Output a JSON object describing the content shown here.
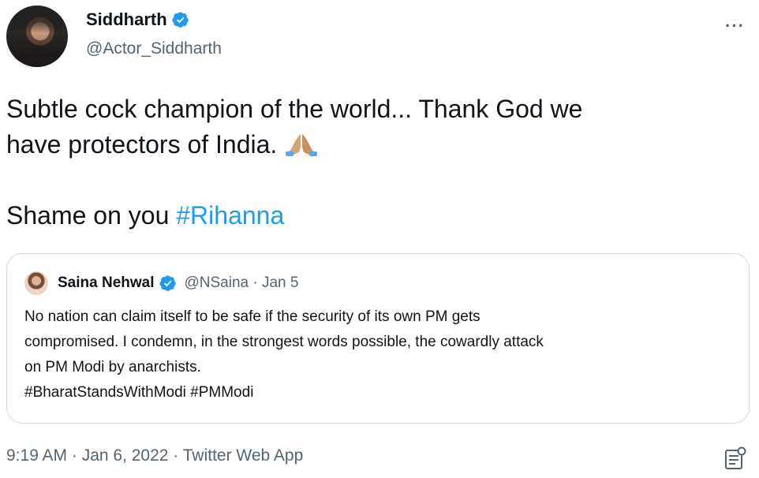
{
  "author": {
    "name": "Siddharth",
    "handle": "@Actor_Siddharth"
  },
  "more_label": "···",
  "tweet": {
    "line1": "Subtle cock champion of the world... Thank God we",
    "line2": "have protectors of India.",
    "line3_prefix": "Shame on you ",
    "line3_hashtag": "#Rihanna",
    "emoji": "folded-hands"
  },
  "quoted": {
    "name": "Saina Nehwal",
    "handle_date": "@NSaina · Jan 5",
    "lines": [
      "No nation can claim itself to be safe if the security of its own PM gets",
      "compromised. I condemn, in the strongest words possible, the cowardly attack",
      "on PM Modi by anarchists.",
      "#BharatStandsWithModi #PMModi"
    ]
  },
  "meta": {
    "timestamp": "9:19 AM · Jan 6, 2022 · Twitter Web App",
    "icon": "analytics-icon"
  },
  "colors": {
    "accent": "#1d9bf0",
    "secondary_text": "#536471",
    "border": "#cfd9de"
  }
}
